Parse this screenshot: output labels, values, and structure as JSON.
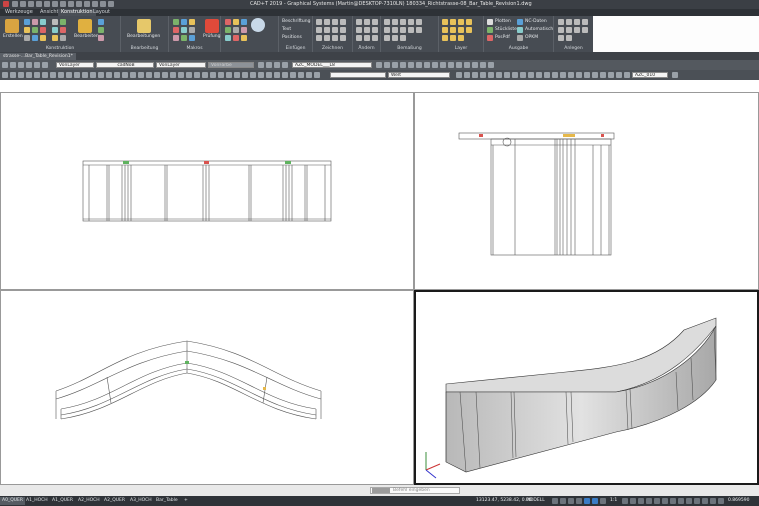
{
  "window": {
    "title": "CAD+T 2019 - Graphical Systems  (Martin@DESKTOP-7310LN)  180334_Richtstrasse-08_Bar_Table_Revision1.dwg"
  },
  "ribbon_tabs": [
    "Werkzeuge",
    "Ansicht",
    "Konstruktion",
    "Layout"
  ],
  "ribbon_active_tab": "Konstruktion",
  "ribbon": {
    "konstruktion": {
      "erstellen": "Erstellen",
      "bearbeiten": "Bearbeiten",
      "label": "Konstruktion"
    },
    "bearbeitung": {
      "bearbeitungen": "Bearbeitungen",
      "label": "Bearbeitung"
    },
    "makros": {
      "pruefung": "Prüfung",
      "label": "Makros"
    },
    "einfuegen": {
      "beschriftung": "Beschriftung",
      "text": "Text",
      "positions": "Positions",
      "label": "Einfügen"
    },
    "zeichnen": {
      "label": "Zeichnen"
    },
    "aendern": {
      "label": "Ändern"
    },
    "bemassung": {
      "label": "Bemaßung"
    },
    "layer": {
      "label": "Layer"
    },
    "ausgabe": {
      "plotten": "Plotten",
      "nc_daten": "NC-Daten",
      "stueckliste": "Stückliste",
      "automatisch": "Automatisch",
      "pospdf": "PosPdf",
      "opkm": "OPKM",
      "label": "Ausgabe"
    },
    "anlegen": {
      "label": "Anlegen"
    }
  },
  "document_tab": "strasse-...Bar_Table_Revision1*",
  "properties_bar": {
    "color": "VonLayer",
    "linetype": "cadNoB",
    "lineweight": "VonLayer",
    "plotstyle": "VonFarbe",
    "layer": "AZC_MODEL___L8",
    "visual_style": "Welt",
    "layer_state": "AZC_010"
  },
  "command": {
    "placeholder": "Befehl eingeben"
  },
  "layout_tabs": [
    "A0_QUER",
    "A1_HOCH",
    "A1_QUER",
    "A2_HOCH",
    "A2_QUER",
    "A3_HOCH",
    "Bar_Table",
    "+"
  ],
  "status": {
    "coordinates": "13123.47, 5238.42, 0.00",
    "mode": "MODELL",
    "scale": "1:1",
    "zoom": "0.869590"
  },
  "viewports": [
    "front-view",
    "side-view",
    "top-view",
    "isometric-view"
  ],
  "colors": {
    "ribbon_bg": "#474c53",
    "titlebar_bg": "#3b3f45",
    "status_bg": "#2f3338",
    "active_viewport_border": "#1a1a1a"
  }
}
